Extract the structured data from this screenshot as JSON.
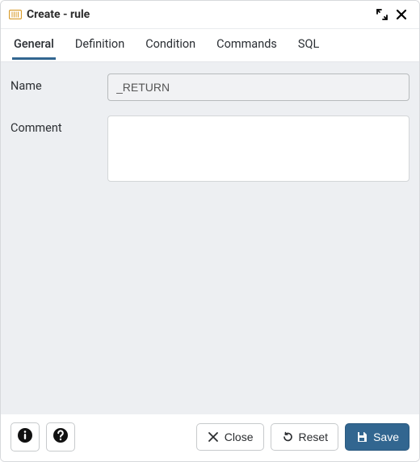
{
  "colors": {
    "accent": "#326690"
  },
  "titlebar": {
    "icon": "rule-icon",
    "title": "Create - rule"
  },
  "tabs": [
    {
      "id": "general",
      "label": "General",
      "active": true
    },
    {
      "id": "definition",
      "label": "Definition",
      "active": false
    },
    {
      "id": "condition",
      "label": "Condition",
      "active": false
    },
    {
      "id": "commands",
      "label": "Commands",
      "active": false
    },
    {
      "id": "sql",
      "label": "SQL",
      "active": false
    }
  ],
  "form": {
    "name": {
      "label": "Name",
      "value": "_RETURN",
      "placeholder": ""
    },
    "comment": {
      "label": "Comment",
      "value": ""
    }
  },
  "footer": {
    "info_tooltip": "SQL help",
    "help_tooltip": "Help",
    "close": "Close",
    "reset": "Reset",
    "save": "Save"
  }
}
